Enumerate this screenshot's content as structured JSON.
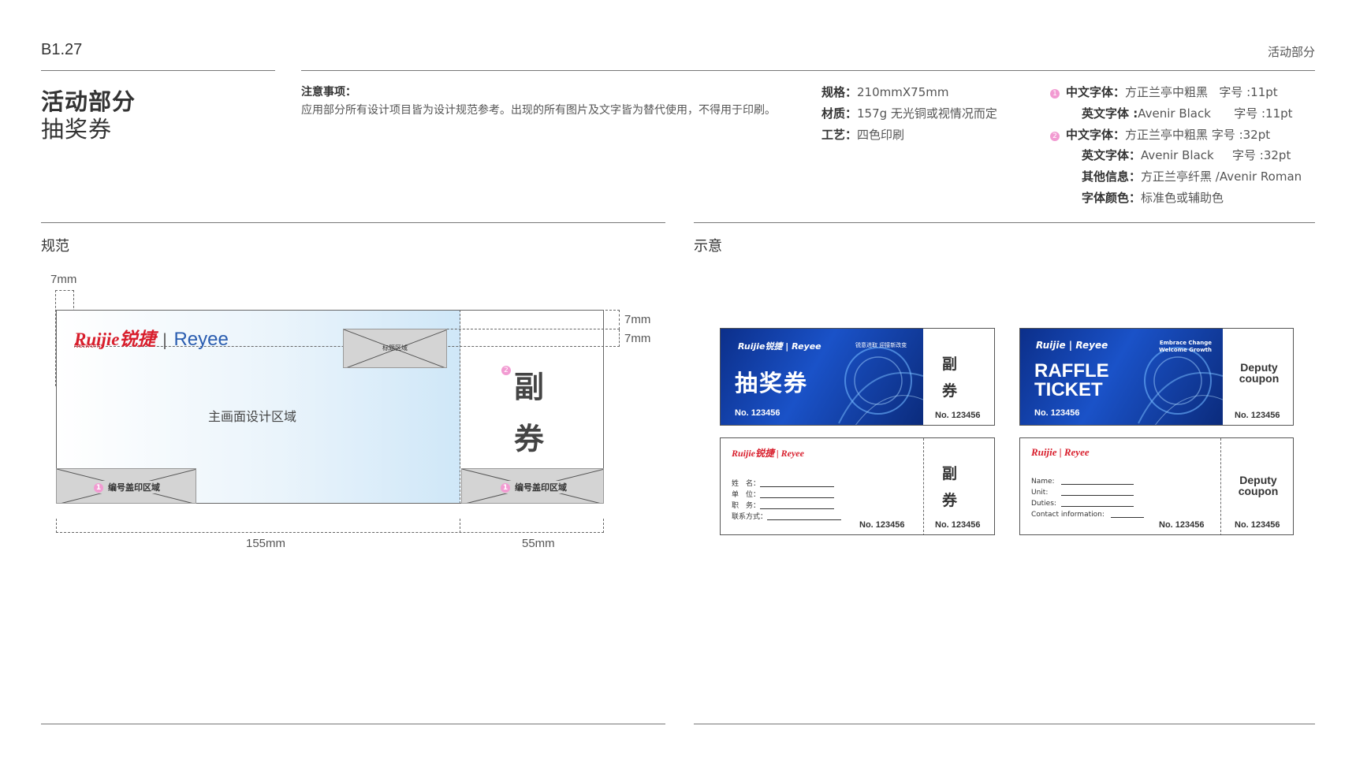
{
  "header": {
    "page_code": "B1.27",
    "section": "活动部分",
    "title_main": "活动部分",
    "title_sub": "抽奖券"
  },
  "notice": {
    "heading": "注意事项：",
    "body": "应用部分所有设计项目皆为设计规范参考。出现的所有图片及文字皆为替代使用，不得用于印刷。"
  },
  "specs": [
    {
      "label": "规格：",
      "value": "210mmX75mm"
    },
    {
      "label": "材质：",
      "value": "157g 无光铜或视情况而定"
    },
    {
      "label": "工艺：",
      "value": "四色印刷"
    }
  ],
  "fonts": [
    {
      "marker": "1",
      "label": "中文字体：",
      "value": "方正兰亭中粗黑",
      "size": "字号 :11pt"
    },
    {
      "marker": "",
      "label": "英文字体 :",
      "value": "Avenir Black",
      "size": "字号 :11pt"
    },
    {
      "marker": "2",
      "label": "中文字体：",
      "value": "方正兰亭中粗黑",
      "size": "字号 :32pt"
    },
    {
      "marker": "",
      "label": "英文字体：",
      "value": "Avenir Black",
      "size": "字号 :32pt"
    },
    {
      "marker": "",
      "label": "其他信息：",
      "value": "方正兰亭纤黑 /Avenir Roman",
      "size": ""
    },
    {
      "marker": "",
      "label": "字体颜色：",
      "value": "标准色或辅助色",
      "size": ""
    }
  ],
  "spec_panel": {
    "heading": "规范",
    "dims": {
      "left_margin": "7mm",
      "top_margin_1": "7mm",
      "top_margin_2": "7mm",
      "main_width": "155mm",
      "stub_width": "55mm"
    },
    "logo_red": "Ruijie锐捷",
    "logo_red_sub": "Networks",
    "logo_sep": "|",
    "logo_blue": "Reyee",
    "logo_box_label": "标题区域",
    "main_area_label": "主画面设计区域",
    "stamp_left": "编号盖印区域",
    "stamp_right": "编号盖印区域",
    "stub_char_1": "副",
    "stub_char_2": "券",
    "marker_1": "1",
    "marker_2": "2"
  },
  "example_panel": {
    "heading": "示意",
    "cn_blue": {
      "logo": "Ruijie锐捷 | Reyee",
      "slogan": "锐意进取 迎接新改变",
      "title": "抽奖券",
      "number": "No. 123456",
      "stub_1": "副",
      "stub_2": "券",
      "stub_number": "No. 123456"
    },
    "en_blue": {
      "logo": "Ruijie | Reyee",
      "slogan_1": "Embrace Change",
      "slogan_2": "Welcome Growth",
      "title_1": "RAFFLE",
      "title_2": "TICKET",
      "number": "No. 123456",
      "stub_1": "Deputy",
      "stub_2": "coupon",
      "stub_number": "No. 123456"
    },
    "cn_white": {
      "logo": "Ruijie锐捷 | Reyee",
      "fields": [
        "姓　名：",
        "单　位：",
        "职　务：",
        "联系方式："
      ],
      "number": "No. 123456",
      "stub_1": "副",
      "stub_2": "券",
      "stub_number": "No. 123456"
    },
    "en_white": {
      "logo": "Ruijie | Reyee",
      "fields": [
        "Name:",
        "Unit:",
        "Duties:",
        "Contact information:"
      ],
      "number": "No. 123456",
      "stub_1": "Deputy",
      "stub_2": "coupon",
      "stub_number": "No. 123456"
    }
  }
}
